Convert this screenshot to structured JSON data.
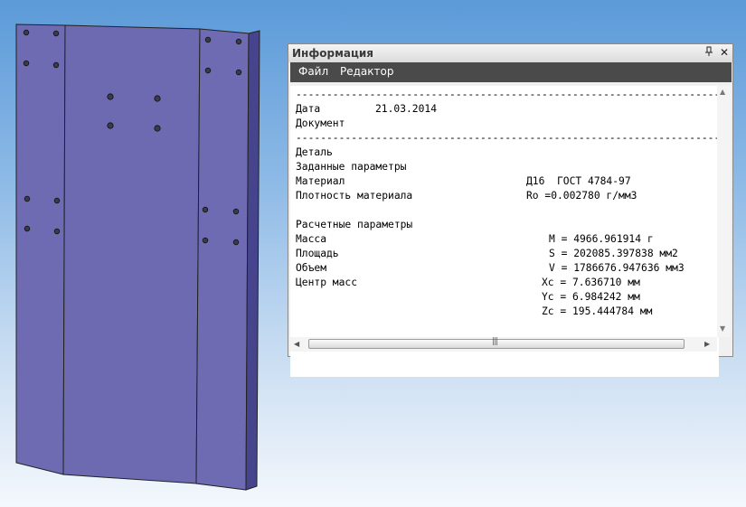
{
  "panel": {
    "title": "Информация",
    "pin_icon": "pin-icon",
    "close_icon": "close-icon"
  },
  "menu": {
    "file": "Файл",
    "edit": "Редактор"
  },
  "report": {
    "separator": "---------------------------------------------------------------------",
    "date_label": "Дата",
    "date_value": "21.03.2014",
    "document_label": "Документ",
    "part_label": "Деталь",
    "given_params_label": "Заданные параметры",
    "material_label": "Материал",
    "material_value": "Д16  ГОСТ 4784-97",
    "density_label": "Плотность материала",
    "density_value": "Ro =0.002780 г/мм3",
    "calc_params_label": "Расчетные параметры",
    "mass_label": "Масса",
    "mass_value": "M = 4966.961914 г",
    "area_label": "Площадь",
    "area_value": "S = 202085.397838 мм2",
    "volume_label": "Объем",
    "volume_value": "V = 1786676.947636 мм3",
    "com_label": "Центр масс",
    "xc_value": "Xc = 7.636710 мм",
    "yc_value": "Yc = 6.984242 мм",
    "zc_value": "Zc = 195.444784 мм"
  },
  "colors": {
    "part_face": "#6f6cb4",
    "part_side": "#4a4990",
    "menubar": "#4a4a4a"
  }
}
